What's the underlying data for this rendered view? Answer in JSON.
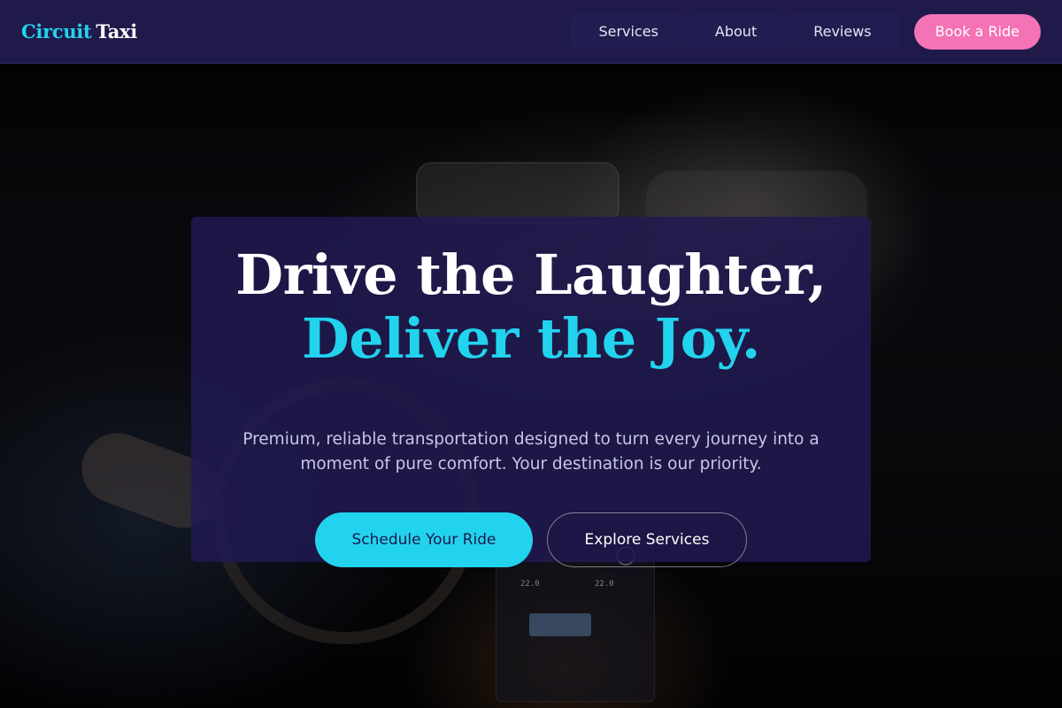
{
  "brand": {
    "name_part1": "Circuit",
    "name_part2": "Taxi"
  },
  "nav": {
    "items": [
      {
        "label": "Services"
      },
      {
        "label": "About"
      },
      {
        "label": "Reviews"
      }
    ],
    "cta_label": "Book a Ride"
  },
  "hero": {
    "headline_line1": "Drive the Laughter,",
    "headline_line2": "Deliver the Joy.",
    "subtitle": "Premium, reliable transportation designed to turn every journey into a moment of pure comfort. Your destination is our priority.",
    "primary_cta": "Schedule Your Ride",
    "secondary_cta": "Explore Services",
    "console_temp_left": "22.0",
    "console_temp_right": "22.0"
  },
  "colors": {
    "nav_background": "#1f1a4a",
    "accent_cyan": "#22d3ee",
    "accent_pink": "#f472b6",
    "card_background": "#1f1a50"
  },
  "icons": {
    "background": "car-interior-night-photo"
  }
}
